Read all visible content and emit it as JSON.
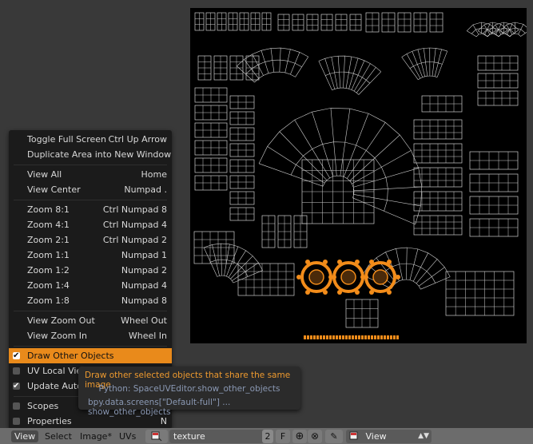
{
  "menu": {
    "items": [
      {
        "label": "Toggle Full Screen",
        "shortcut": "Ctrl Up Arrow"
      },
      {
        "label": "Duplicate Area into New Window",
        "shortcut": ""
      },
      {
        "label": "View All",
        "shortcut": "Home"
      },
      {
        "label": "View Center",
        "shortcut": "Numpad ."
      },
      {
        "label": "Zoom 8:1",
        "shortcut": "Ctrl Numpad 8"
      },
      {
        "label": "Zoom 4:1",
        "shortcut": "Ctrl Numpad 4"
      },
      {
        "label": "Zoom 2:1",
        "shortcut": "Ctrl Numpad 2"
      },
      {
        "label": "Zoom 1:1",
        "shortcut": "Numpad 1"
      },
      {
        "label": "Zoom 1:2",
        "shortcut": "Numpad 2"
      },
      {
        "label": "Zoom 1:4",
        "shortcut": "Numpad 4"
      },
      {
        "label": "Zoom 1:8",
        "shortcut": "Numpad 8"
      },
      {
        "label": "View Zoom Out",
        "shortcut": "Wheel Out"
      },
      {
        "label": "View Zoom In",
        "shortcut": "Wheel In"
      },
      {
        "label": "Draw Other Objects",
        "shortcut": "",
        "checked": true
      },
      {
        "label": "UV Local View",
        "shortcut": "",
        "checked": false
      },
      {
        "label": "Update Autom",
        "shortcut": "",
        "checked": true
      },
      {
        "label": "Scopes",
        "shortcut": "",
        "checked": false
      },
      {
        "label": "Properties",
        "shortcut": "N",
        "checked": false
      }
    ]
  },
  "tooltip": {
    "description": "Draw other selected objects that share the same image",
    "python": "Python: SpaceUVEditor.show_other_objects",
    "path": "bpy.data.screens[\"Default-full\"] ... show_other_objects"
  },
  "header": {
    "view": "View",
    "select": "Select",
    "image": "Image*",
    "uvs": "UVs",
    "texture_name": "texture",
    "users": "2",
    "fake_user": "F",
    "mode": "View"
  },
  "colors": {
    "accent": "#e98a1b",
    "selected_uv": "#f28c1a",
    "wire": "#cfcfcf"
  }
}
